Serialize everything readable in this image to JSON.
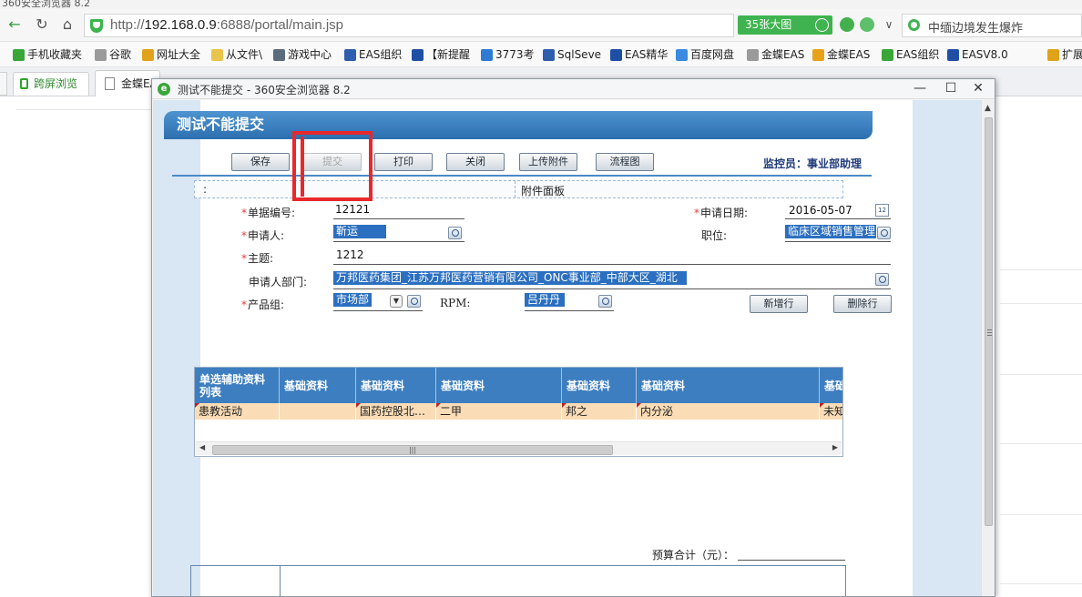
{
  "browser": {
    "title_fragment": "360安全浏览器 8.2",
    "url_prefix": "http://",
    "url_host": "192.168.0.9",
    "url_rest": ":6888/portal/main.jsp",
    "big_image_label": "35张大图",
    "search_text": "中缅边境发生爆炸",
    "bookmarks": [
      {
        "label": "手机收藏夹",
        "color": "#3aa63a"
      },
      {
        "label": "谷歌",
        "color": "#9a9a9a"
      },
      {
        "label": "网址大全",
        "color": "#e0a21a"
      },
      {
        "label": "从文件\\",
        "color": "#e8c44a"
      },
      {
        "label": "游戏中心",
        "color": "#5a6b7d"
      },
      {
        "label": "EAS组织",
        "color": "#2d5fae"
      },
      {
        "label": "【新提醒",
        "color": "#1f4fa5"
      },
      {
        "label": "3773考",
        "color": "#2f7ad3"
      },
      {
        "label": "SqlSeve",
        "color": "#2d5fae"
      },
      {
        "label": "EAS精华",
        "color": "#1f4fa5"
      },
      {
        "label": "百度网盘",
        "color": "#3a8be0"
      },
      {
        "label": "金蝶EAS",
        "color": "#9a9a9a"
      },
      {
        "label": "金蝶EAS",
        "color": "#e8a21a"
      },
      {
        "label": "EAS组织",
        "color": "#3aa63a"
      },
      {
        "label": "EASV8.0",
        "color": "#1f4fa5"
      },
      {
        "label": "扩展",
        "color": "#e0a21a"
      }
    ],
    "tab_split_label": "跨屏浏览",
    "tab_active_label": "金蝶EAS"
  },
  "popup": {
    "window_title": "测试不能提交 - 360安全浏览器 8.2",
    "form_title": "测试不能提交",
    "toolbar": {
      "save": "保存",
      "submit": "提交",
      "print": "打印",
      "close": "关闭",
      "upload": "上传附件",
      "flow": "流程图"
    },
    "monitor": "监控员：事业部助理",
    "attach_colon": ":",
    "attach_panel": "附件面板",
    "fields": {
      "bill_no_label": "单据编号:",
      "bill_no": "12121",
      "apply_date_label": "申请日期:",
      "apply_date": "2016-05-07",
      "applicant_label": "申请人:",
      "applicant": "靳运",
      "position_label": "职位:",
      "position": "临床区域销售管理",
      "subject_label": "主题:",
      "subject": "1212",
      "dept_label": "申请人部门:",
      "dept": "万邦医药集团_江苏万邦医药营销有限公司_ONC事业部_中部大区_湖北",
      "product_group_label": "产品组:",
      "product_group": "市场部",
      "rpm_label": "RPM:",
      "rpm": "吕丹丹"
    },
    "add_row": "新增行",
    "delete_row": "删除行",
    "grid": {
      "headers": [
        "单选辅助资料列表",
        "基础资料",
        "基础资料",
        "基础资料",
        "基础资料",
        "基础资料",
        "基础"
      ],
      "row": [
        "患教活动",
        "",
        "国药控股北…",
        "二甲",
        "邦之",
        "内分泌",
        "未知"
      ]
    },
    "budget_label": "预算合计（元）："
  }
}
